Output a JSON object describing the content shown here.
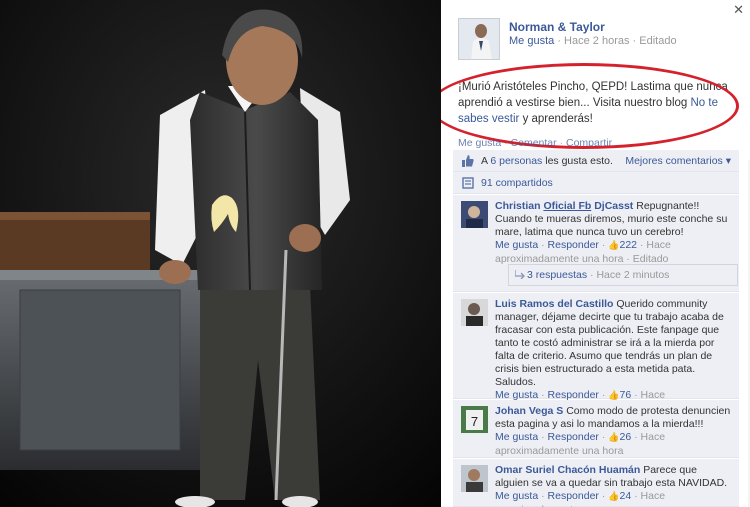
{
  "post": {
    "page_name": "Norman & Taylor",
    "like_label": "Me gusta",
    "time": "Hace 2 horas",
    "edited": "Editado",
    "text_main": "¡Murió Aristóteles Pincho, QEPD! Lastima que nunca aprendió a vestirse bien... Visita nuestro blog",
    "blog_link": "No te sabes vestir",
    "text_end": "y aprenderás!",
    "action_like": "Me gusta",
    "action_comment": "Comentar",
    "action_share": "Compartir"
  },
  "stats": {
    "likes_prefix": "A",
    "likes_link": "6 personas",
    "likes_suffix": "les gusta esto.",
    "best_comments": "Mejores comentarios ▾",
    "shares": "91 compartidos"
  },
  "comments": [
    {
      "name_a": "Christian",
      "name_b": "Oficial Fb",
      "name_c": "DjCasst",
      "text": "Repugnante!! Cuando te mueras diremos, murio este conche su mare, latima que nunca tuvo un cerebro!",
      "like": "Me gusta",
      "reply": "Responder",
      "count": "222",
      "time": "Hace aproximadamente una hora",
      "edited": "Editado",
      "replies": "3 respuestas",
      "replies_time": "Hace 2 minutos"
    },
    {
      "name": "Luis Ramos del Castillo",
      "text": "Querido community manager, déjame decirte que tu trabajo acaba de fracasar con esta publicación. Este fanpage que tanto te costó administrar se irá a la mierda por falta de criterio. Asumo que tendrás un plan de crisis bien estructurado a esta metida pata. Saludos.",
      "like": "Me gusta",
      "reply": "Responder",
      "count": "76",
      "time": "Hace aproximadamente una hora"
    },
    {
      "name": "Johan Vega S",
      "text": "Como modo de protesta denuncien esta pagina y asi lo mandamos a la mierda!!!",
      "like": "Me gusta",
      "reply": "Responder",
      "count": "26",
      "time": "Hace aproximadamente una hora"
    },
    {
      "name": "Omar Suriel Chacón Huamán",
      "text": "Parece que alguien se va a quedar sin trabajo esta NAVIDAD.",
      "like": "Me gusta",
      "reply": "Responder",
      "count": "24",
      "time": "Hace aproximadamente"
    }
  ],
  "icons": {
    "close": "close-icon",
    "like": "thumbs-up-icon",
    "share": "share-icon",
    "reply": "reply-arrow-icon"
  },
  "colors": {
    "link": "#3b5998",
    "annotation": "#d4212b",
    "comment_bg": "#edeff4"
  }
}
